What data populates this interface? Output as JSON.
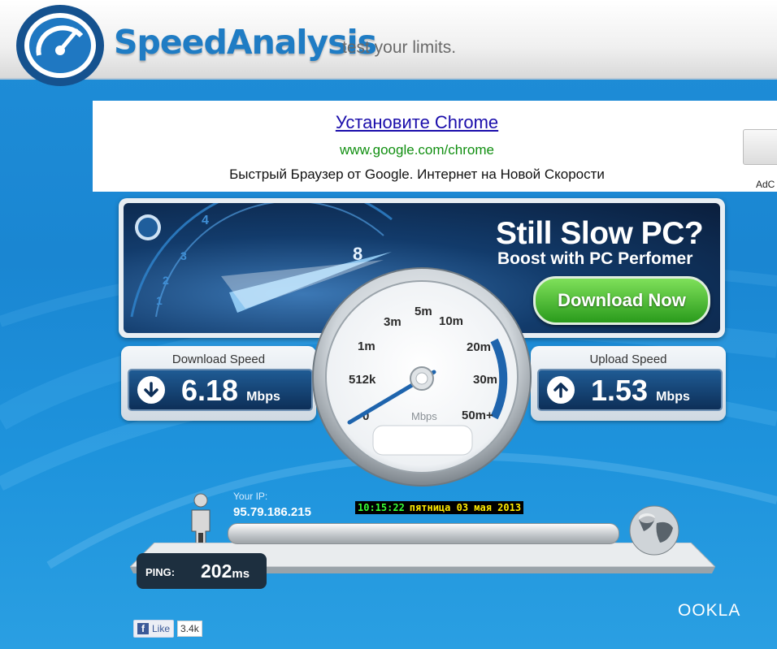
{
  "header": {
    "brand": "SpeedAnalysis",
    "tagline": "test your limits."
  },
  "ad": {
    "title": "Установите Chrome",
    "url": "www.google.com/chrome",
    "description": "Быстрый Браузер от Google. Интернет на Новой Скорости",
    "side_label": "AdC"
  },
  "banner": {
    "title": "Still Slow PC?",
    "subtitle": "Boost with PC Perfomer",
    "cta": "Download Now",
    "dial_numbers": [
      "1",
      "2",
      "3",
      "4",
      "8"
    ]
  },
  "download": {
    "label": "Download Speed",
    "value": "6.18",
    "unit": "Mbps"
  },
  "upload": {
    "label": "Upload Speed",
    "value": "1.53",
    "unit": "Mbps"
  },
  "gauge": {
    "ticks": [
      "0",
      "512k",
      "1m",
      "3m",
      "5m",
      "10m",
      "20m",
      "30m",
      "50m+"
    ],
    "unit": "Mbps",
    "needle_value": "6.18"
  },
  "ip": {
    "label": "Your IP:",
    "value": "95.79.186.215"
  },
  "clock": {
    "time": "10:15:22",
    "date": "пятница 03 мая 2013"
  },
  "ping": {
    "label": "PING:",
    "value": "202",
    "unit": "ms"
  },
  "footer": {
    "brand": "OOKLA",
    "like_label": "Like",
    "like_count": "3.4k"
  },
  "colors": {
    "accent": "#1f7cc4",
    "bg": "#1a86d2",
    "cta_green": "#2a9b1c"
  }
}
